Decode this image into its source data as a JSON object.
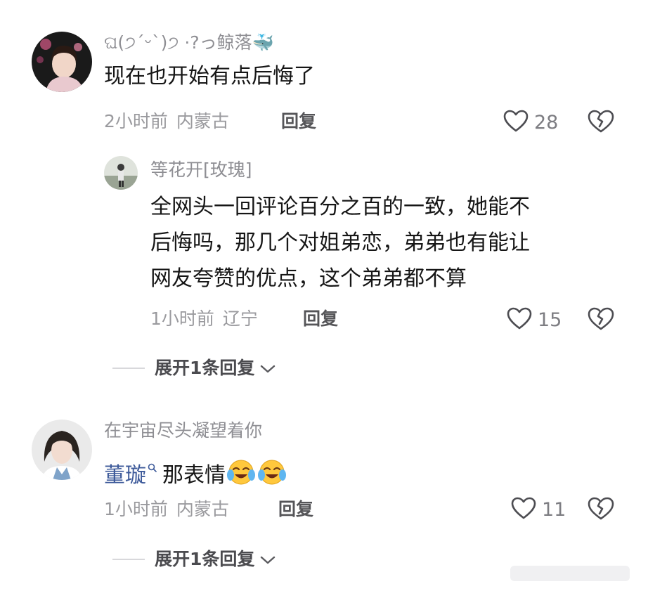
{
  "comments": [
    {
      "user": "ଘ(੭ˊᵕˋ)੭ ·?っ鲸落🐳",
      "text": "现在也开始有点后悔了",
      "time": "2小时前",
      "location": "内蒙古",
      "reply_label": "回复",
      "likes": "28",
      "replies": [
        {
          "user": "等花开[玫瑰]",
          "text_lines": [
            "全网头一回评论百分之百的一致，她能不",
            "后悔吗，那几个对姐弟恋，弟弟也有能让",
            "网友夸赞的优点，这个弟弟都不算"
          ],
          "time": "1小时前",
          "location": "辽宁",
          "reply_label": "回复",
          "likes": "15"
        }
      ],
      "expand_label": "展开1条回复"
    },
    {
      "user": "在宇宙尽头凝望着你",
      "mention": "董璇",
      "text": "那表情",
      "emoji": [
        "crying-laughing-face",
        "crying-laughing-face"
      ],
      "time": "1小时前",
      "location": "内蒙古",
      "reply_label": "回复",
      "likes": "11",
      "expand_label": "展开1条回复"
    }
  ],
  "colors": {
    "nickname": "#8e8e93",
    "text": "#161616",
    "meta": "#9a9a9e",
    "mention": "#3d5a9a"
  },
  "icons": [
    "heart-outline-icon",
    "broken-heart-icon",
    "chevron-down-icon",
    "search-icon"
  ]
}
